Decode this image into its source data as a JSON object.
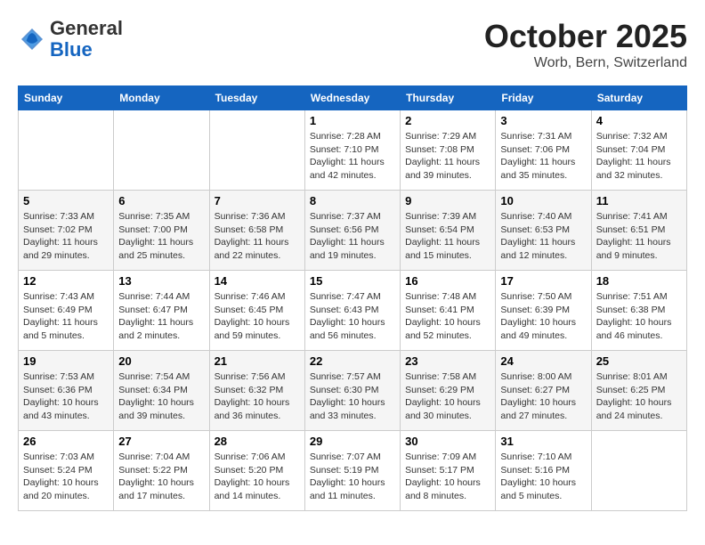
{
  "header": {
    "logo_general": "General",
    "logo_blue": "Blue",
    "month": "October 2025",
    "location": "Worb, Bern, Switzerland"
  },
  "weekdays": [
    "Sunday",
    "Monday",
    "Tuesday",
    "Wednesday",
    "Thursday",
    "Friday",
    "Saturday"
  ],
  "weeks": [
    [
      {
        "day": "",
        "sunrise": "",
        "sunset": "",
        "daylight": ""
      },
      {
        "day": "",
        "sunrise": "",
        "sunset": "",
        "daylight": ""
      },
      {
        "day": "",
        "sunrise": "",
        "sunset": "",
        "daylight": ""
      },
      {
        "day": "1",
        "sunrise": "Sunrise: 7:28 AM",
        "sunset": "Sunset: 7:10 PM",
        "daylight": "Daylight: 11 hours and 42 minutes."
      },
      {
        "day": "2",
        "sunrise": "Sunrise: 7:29 AM",
        "sunset": "Sunset: 7:08 PM",
        "daylight": "Daylight: 11 hours and 39 minutes."
      },
      {
        "day": "3",
        "sunrise": "Sunrise: 7:31 AM",
        "sunset": "Sunset: 7:06 PM",
        "daylight": "Daylight: 11 hours and 35 minutes."
      },
      {
        "day": "4",
        "sunrise": "Sunrise: 7:32 AM",
        "sunset": "Sunset: 7:04 PM",
        "daylight": "Daylight: 11 hours and 32 minutes."
      }
    ],
    [
      {
        "day": "5",
        "sunrise": "Sunrise: 7:33 AM",
        "sunset": "Sunset: 7:02 PM",
        "daylight": "Daylight: 11 hours and 29 minutes."
      },
      {
        "day": "6",
        "sunrise": "Sunrise: 7:35 AM",
        "sunset": "Sunset: 7:00 PM",
        "daylight": "Daylight: 11 hours and 25 minutes."
      },
      {
        "day": "7",
        "sunrise": "Sunrise: 7:36 AM",
        "sunset": "Sunset: 6:58 PM",
        "daylight": "Daylight: 11 hours and 22 minutes."
      },
      {
        "day": "8",
        "sunrise": "Sunrise: 7:37 AM",
        "sunset": "Sunset: 6:56 PM",
        "daylight": "Daylight: 11 hours and 19 minutes."
      },
      {
        "day": "9",
        "sunrise": "Sunrise: 7:39 AM",
        "sunset": "Sunset: 6:54 PM",
        "daylight": "Daylight: 11 hours and 15 minutes."
      },
      {
        "day": "10",
        "sunrise": "Sunrise: 7:40 AM",
        "sunset": "Sunset: 6:53 PM",
        "daylight": "Daylight: 11 hours and 12 minutes."
      },
      {
        "day": "11",
        "sunrise": "Sunrise: 7:41 AM",
        "sunset": "Sunset: 6:51 PM",
        "daylight": "Daylight: 11 hours and 9 minutes."
      }
    ],
    [
      {
        "day": "12",
        "sunrise": "Sunrise: 7:43 AM",
        "sunset": "Sunset: 6:49 PM",
        "daylight": "Daylight: 11 hours and 5 minutes."
      },
      {
        "day": "13",
        "sunrise": "Sunrise: 7:44 AM",
        "sunset": "Sunset: 6:47 PM",
        "daylight": "Daylight: 11 hours and 2 minutes."
      },
      {
        "day": "14",
        "sunrise": "Sunrise: 7:46 AM",
        "sunset": "Sunset: 6:45 PM",
        "daylight": "Daylight: 10 hours and 59 minutes."
      },
      {
        "day": "15",
        "sunrise": "Sunrise: 7:47 AM",
        "sunset": "Sunset: 6:43 PM",
        "daylight": "Daylight: 10 hours and 56 minutes."
      },
      {
        "day": "16",
        "sunrise": "Sunrise: 7:48 AM",
        "sunset": "Sunset: 6:41 PM",
        "daylight": "Daylight: 10 hours and 52 minutes."
      },
      {
        "day": "17",
        "sunrise": "Sunrise: 7:50 AM",
        "sunset": "Sunset: 6:39 PM",
        "daylight": "Daylight: 10 hours and 49 minutes."
      },
      {
        "day": "18",
        "sunrise": "Sunrise: 7:51 AM",
        "sunset": "Sunset: 6:38 PM",
        "daylight": "Daylight: 10 hours and 46 minutes."
      }
    ],
    [
      {
        "day": "19",
        "sunrise": "Sunrise: 7:53 AM",
        "sunset": "Sunset: 6:36 PM",
        "daylight": "Daylight: 10 hours and 43 minutes."
      },
      {
        "day": "20",
        "sunrise": "Sunrise: 7:54 AM",
        "sunset": "Sunset: 6:34 PM",
        "daylight": "Daylight: 10 hours and 39 minutes."
      },
      {
        "day": "21",
        "sunrise": "Sunrise: 7:56 AM",
        "sunset": "Sunset: 6:32 PM",
        "daylight": "Daylight: 10 hours and 36 minutes."
      },
      {
        "day": "22",
        "sunrise": "Sunrise: 7:57 AM",
        "sunset": "Sunset: 6:30 PM",
        "daylight": "Daylight: 10 hours and 33 minutes."
      },
      {
        "day": "23",
        "sunrise": "Sunrise: 7:58 AM",
        "sunset": "Sunset: 6:29 PM",
        "daylight": "Daylight: 10 hours and 30 minutes."
      },
      {
        "day": "24",
        "sunrise": "Sunrise: 8:00 AM",
        "sunset": "Sunset: 6:27 PM",
        "daylight": "Daylight: 10 hours and 27 minutes."
      },
      {
        "day": "25",
        "sunrise": "Sunrise: 8:01 AM",
        "sunset": "Sunset: 6:25 PM",
        "daylight": "Daylight: 10 hours and 24 minutes."
      }
    ],
    [
      {
        "day": "26",
        "sunrise": "Sunrise: 7:03 AM",
        "sunset": "Sunset: 5:24 PM",
        "daylight": "Daylight: 10 hours and 20 minutes."
      },
      {
        "day": "27",
        "sunrise": "Sunrise: 7:04 AM",
        "sunset": "Sunset: 5:22 PM",
        "daylight": "Daylight: 10 hours and 17 minutes."
      },
      {
        "day": "28",
        "sunrise": "Sunrise: 7:06 AM",
        "sunset": "Sunset: 5:20 PM",
        "daylight": "Daylight: 10 hours and 14 minutes."
      },
      {
        "day": "29",
        "sunrise": "Sunrise: 7:07 AM",
        "sunset": "Sunset: 5:19 PM",
        "daylight": "Daylight: 10 hours and 11 minutes."
      },
      {
        "day": "30",
        "sunrise": "Sunrise: 7:09 AM",
        "sunset": "Sunset: 5:17 PM",
        "daylight": "Daylight: 10 hours and 8 minutes."
      },
      {
        "day": "31",
        "sunrise": "Sunrise: 7:10 AM",
        "sunset": "Sunset: 5:16 PM",
        "daylight": "Daylight: 10 hours and 5 minutes."
      },
      {
        "day": "",
        "sunrise": "",
        "sunset": "",
        "daylight": ""
      }
    ]
  ]
}
